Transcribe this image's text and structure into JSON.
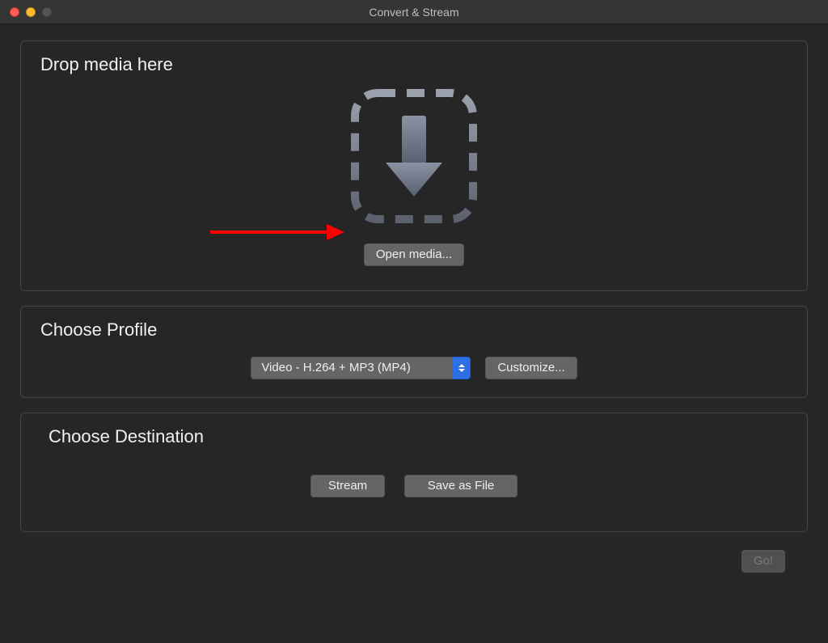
{
  "window": {
    "title": "Convert & Stream"
  },
  "drop": {
    "title": "Drop media here",
    "open_label": "Open media..."
  },
  "profile": {
    "title": "Choose Profile",
    "selected": "Video - H.264 + MP3 (MP4)",
    "customize_label": "Customize..."
  },
  "destination": {
    "title": "Choose Destination",
    "stream_label": "Stream",
    "save_label": "Save as File"
  },
  "footer": {
    "go_label": "Go!"
  },
  "annotation": {
    "arrow_color": "#ff0000"
  }
}
